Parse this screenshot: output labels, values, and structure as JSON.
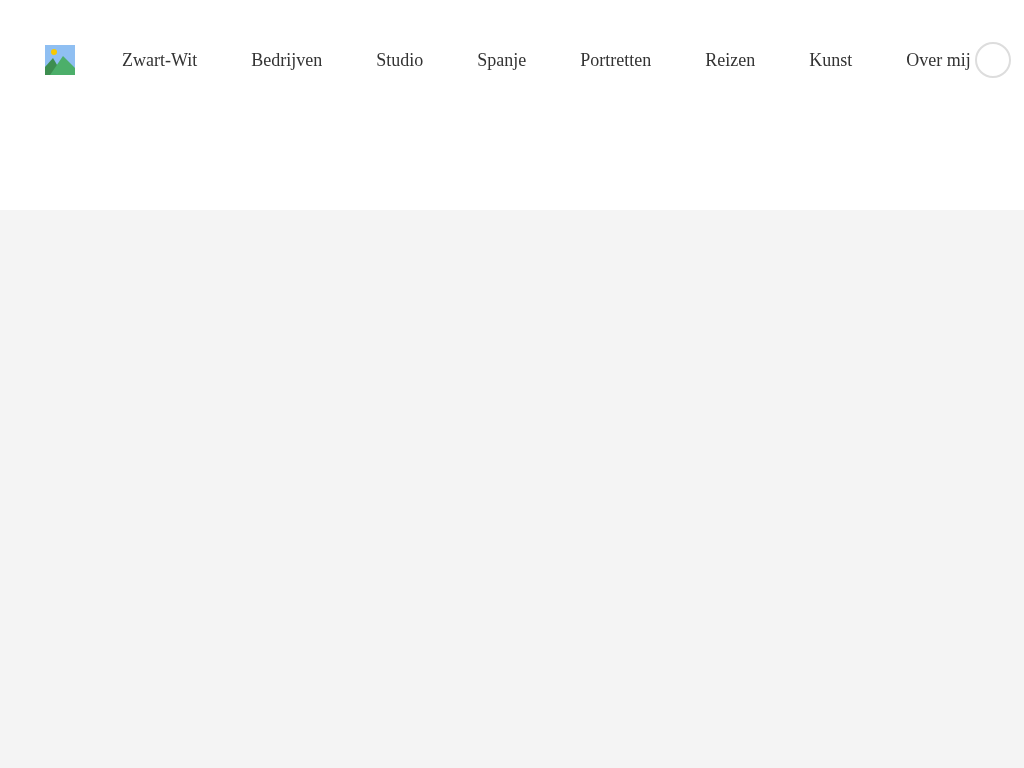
{
  "header": {
    "nav": [
      {
        "label": "Zwart-Wit"
      },
      {
        "label": "Bedrijven"
      },
      {
        "label": "Studio"
      },
      {
        "label": "Spanje"
      },
      {
        "label": "Portretten"
      },
      {
        "label": "Reizen"
      },
      {
        "label": "Kunst"
      },
      {
        "label": "Over mij"
      }
    ]
  }
}
